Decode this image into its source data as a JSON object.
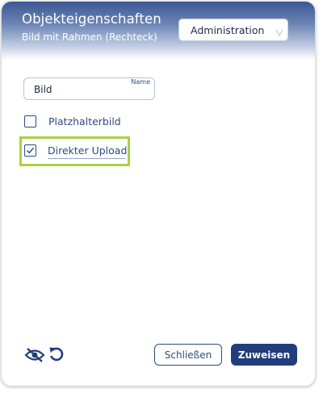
{
  "dialog": {
    "title": "Objekteigenschaften",
    "subtitle": "Bild mit Rahmen (Rechteck)"
  },
  "role_select": {
    "value": "Administration"
  },
  "name_field": {
    "label": "Name",
    "value": "Bild"
  },
  "options": [
    {
      "label": "Platzhalterbild",
      "checked": false
    },
    {
      "label": "Direkter Upload",
      "checked": true
    }
  ],
  "footer": {
    "icons": [
      "eye-slash-icon",
      "undo-icon"
    ],
    "close_label": "Schließen",
    "assign_label": "Zuweisen"
  },
  "colors": {
    "primary": "#223d7c",
    "highlight": "#a9d143",
    "header_gradient_top": "#3a5793"
  }
}
